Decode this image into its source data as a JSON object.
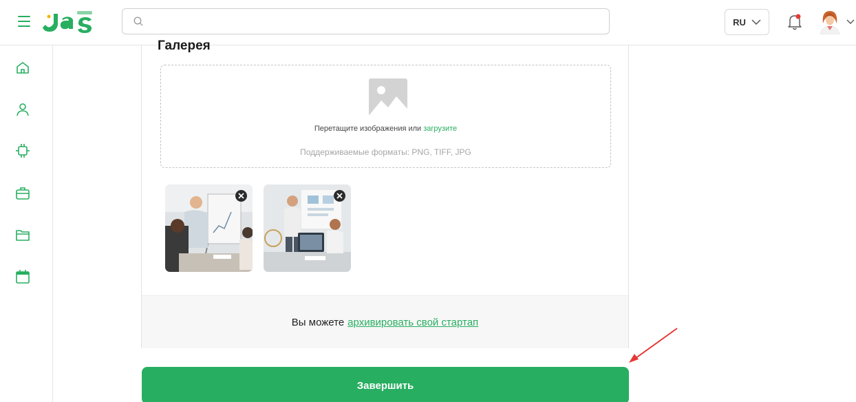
{
  "header": {
    "search": {
      "value": "",
      "placeholder": ""
    },
    "language": {
      "selected": "RU"
    },
    "icons": [
      "menu-icon",
      "search-icon",
      "chevron-down-icon",
      "bell-icon",
      "avatar",
      "chevron-down-icon"
    ]
  },
  "sidebar": {
    "items": [
      {
        "icon": "home-icon"
      },
      {
        "icon": "user-icon"
      },
      {
        "icon": "chip-icon"
      },
      {
        "icon": "briefcase-icon"
      },
      {
        "icon": "folder-icon"
      },
      {
        "icon": "calendar-icon"
      }
    ]
  },
  "gallery": {
    "title": "Галерея",
    "dropzone": {
      "prompt": "Перетащите изображения или",
      "upload_link": "загрузите",
      "formats": "Поддерживаемые форматы: PNG, TIFF, JPG"
    },
    "thumbnails": [
      {
        "icon": "photo-presentation-1"
      },
      {
        "icon": "photo-presentation-2"
      }
    ]
  },
  "archive": {
    "prefix": "Вы можете",
    "link": "архивировать свой стартап"
  },
  "actions": {
    "finish_label": "Завершить"
  },
  "colors": {
    "accent": "#27ae60",
    "annotation_arrow": "#e53935",
    "notification_dot": "#e53935"
  }
}
